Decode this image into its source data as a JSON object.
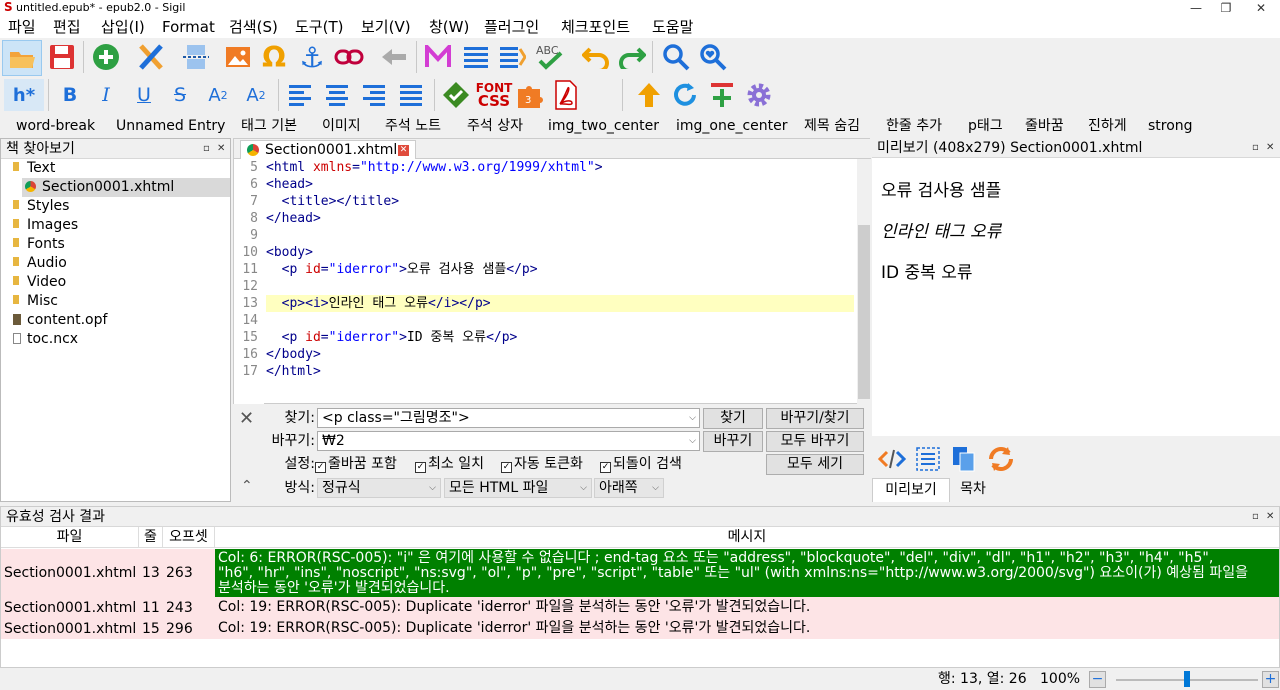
{
  "window": {
    "title": "untitled.epub* - epub2.0 - Sigil",
    "minimize": "—",
    "maximize": "❐",
    "close": "✕"
  },
  "menu": [
    "파일",
    "편집",
    "삽입(I)",
    "Format",
    "검색(S)",
    "도구(T)",
    "보기(V)",
    "창(W)",
    "플러그인",
    "체크포인트",
    "도움말"
  ],
  "toolbar1": [
    "open-folder",
    "save",
    "add-file",
    "tool-x",
    "split",
    "insert-image",
    "special-char",
    "anchor",
    "link",
    "back",
    "meta-editor",
    "toc",
    "toc-gen",
    "spellcheck",
    "undo",
    "redo",
    "find",
    "find-heart"
  ],
  "toolbar2": {
    "heading_label": "h*",
    "bold": "B",
    "italic": "I",
    "underline": "U",
    "strike": "S",
    "sub": "A",
    "sub2": "2",
    "sup": "A",
    "sup2": "2",
    "font_css_1": "FONT",
    "font_css_2": "CSS",
    "plugin_badge": "3"
  },
  "clips": [
    "word-break",
    "Unnamed Entry",
    "태그 기본",
    "이미지",
    "주석 노트",
    "주석 상자",
    "img_two_center",
    "img_one_center",
    "제목 숨김",
    "한줄 추가",
    "p태그",
    "줄바꿈",
    "진하게",
    "strong"
  ],
  "book_browser": {
    "title": "책 찾아보기",
    "items": [
      {
        "label": "Text",
        "type": "folder"
      },
      {
        "label": "Section0001.xhtml",
        "type": "xhtml",
        "selected": true
      },
      {
        "label": "Styles",
        "type": "folder"
      },
      {
        "label": "Images",
        "type": "folder"
      },
      {
        "label": "Fonts",
        "type": "folder"
      },
      {
        "label": "Audio",
        "type": "folder"
      },
      {
        "label": "Video",
        "type": "folder"
      },
      {
        "label": "Misc",
        "type": "folder"
      },
      {
        "label": "content.opf",
        "type": "opf"
      },
      {
        "label": "toc.ncx",
        "type": "ncx"
      }
    ]
  },
  "editor": {
    "tab_label": "Section0001.xhtml",
    "lines": [
      {
        "n": "5",
        "parts": [
          [
            "tag",
            "<html "
          ],
          [
            "attr",
            "xmlns"
          ],
          [
            "tag",
            "="
          ],
          [
            "val",
            "\"http://www.w3.org/1999/xhtml\""
          ],
          [
            "tag",
            ">"
          ]
        ]
      },
      {
        "n": "6",
        "parts": [
          [
            "tag",
            "<head>"
          ]
        ]
      },
      {
        "n": "7",
        "parts": [
          [
            "txt",
            "  "
          ],
          [
            "tag",
            "<title></title>"
          ]
        ]
      },
      {
        "n": "8",
        "parts": [
          [
            "tag",
            "</head>"
          ]
        ]
      },
      {
        "n": "9",
        "parts": []
      },
      {
        "n": "10",
        "parts": [
          [
            "tag",
            "<body>"
          ]
        ]
      },
      {
        "n": "11",
        "parts": [
          [
            "txt",
            "  "
          ],
          [
            "tag",
            "<p "
          ],
          [
            "attr",
            "id"
          ],
          [
            "tag",
            "="
          ],
          [
            "val",
            "\"iderror\""
          ],
          [
            "tag",
            ">"
          ],
          [
            "txt",
            "오류 검사용 샘플"
          ],
          [
            "tag",
            "</p>"
          ]
        ]
      },
      {
        "n": "12",
        "parts": []
      },
      {
        "n": "13",
        "parts": [
          [
            "txt",
            "  "
          ],
          [
            "tag",
            "<p><i>"
          ],
          [
            "txt",
            "인라인 태그 오류"
          ],
          [
            "tag",
            "</i></p>"
          ]
        ],
        "current": true
      },
      {
        "n": "14",
        "parts": []
      },
      {
        "n": "15",
        "parts": [
          [
            "txt",
            "  "
          ],
          [
            "tag",
            "<p "
          ],
          [
            "attr",
            "id"
          ],
          [
            "tag",
            "="
          ],
          [
            "val",
            "\"iderror\""
          ],
          [
            "tag",
            ">"
          ],
          [
            "txt",
            "ID 중복 오류"
          ],
          [
            "tag",
            "</p>"
          ]
        ]
      },
      {
        "n": "16",
        "parts": [
          [
            "tag",
            "</body>"
          ]
        ]
      },
      {
        "n": "17",
        "parts": [
          [
            "tag",
            "</html>"
          ]
        ]
      }
    ]
  },
  "find": {
    "find_label": "찾기:",
    "find_value": "<p class=\"그림명조\">",
    "replace_label": "바꾸기:",
    "replace_value": "₩2",
    "options_label": "설정:",
    "option_linebreak": "줄바꿈 포함",
    "option_minimal": "최소 일치",
    "option_autotoken": "자동 토큰화",
    "option_wrap": "되돌이 검색",
    "mode_label": "방식:",
    "mode_value": "정규식",
    "scope_value": "모든 HTML 파일",
    "direction_value": "아래쪽",
    "btn_find": "찾기",
    "btn_replace_find": "바꾸기/찾기",
    "btn_replace": "바꾸기",
    "btn_replace_all": "모두 바꾸기",
    "btn_count_all": "모두 세기"
  },
  "preview": {
    "title": "미리보기 (408x279) Section0001.xhtml",
    "lines": [
      "오류 검사용 샘플",
      "인라인 태그 오류",
      "ID 중복 오류"
    ],
    "tab_preview": "미리보기",
    "tab_toc": "목차"
  },
  "validation": {
    "title": "유효성 검사 결과",
    "headers": [
      "파일",
      "줄",
      "오프셋",
      "메시지"
    ],
    "rows": [
      {
        "file": "Section0001.xhtml",
        "line": "13",
        "offset": "263",
        "msg1": "Col: 6: ERROR(RSC-005): \"i\" 은 여기에 사용할 수 없습니다 ; end-tag 요소 또는 \"address\", \"blockquote\", \"del\", \"div\", \"dl\", \"h1\", \"h2\", \"h3\", \"h4\", \"h5\",",
        "msg2": "\"h6\", \"hr\", \"ins\", \"noscript\", \"ns:svg\", \"ol\", \"p\", \"pre\", \"script\", \"table\" 또는 \"ul\" (with xmlns:ns=\"http://www.w3.org/2000/svg\") 요소이(가) 예상됨 파일을",
        "msg3": "분석하는 동안 '오류'가 발견되었습니다.",
        "selected": true
      },
      {
        "file": "Section0001.xhtml",
        "line": "11",
        "offset": "243",
        "msg1": "Col: 19: ERROR(RSC-005): Duplicate 'iderror' 파일을 분석하는 동안 '오류'가 발견되었습니다."
      },
      {
        "file": "Section0001.xhtml",
        "line": "15",
        "offset": "296",
        "msg1": "Col: 19: ERROR(RSC-005): Duplicate 'iderror' 파일을 분석하는 동안 '오류'가 발견되었습니다."
      }
    ]
  },
  "status": {
    "position": "행: 13, 열: 26",
    "zoom": "100%",
    "zoom_out": "−",
    "zoom_in": "+",
    "zoom_level": 0.5
  },
  "colors": {
    "accent": "#0078d7",
    "selected_row": "#008000",
    "error_row": "#fde4e6",
    "current_line": "#ffffc0"
  }
}
